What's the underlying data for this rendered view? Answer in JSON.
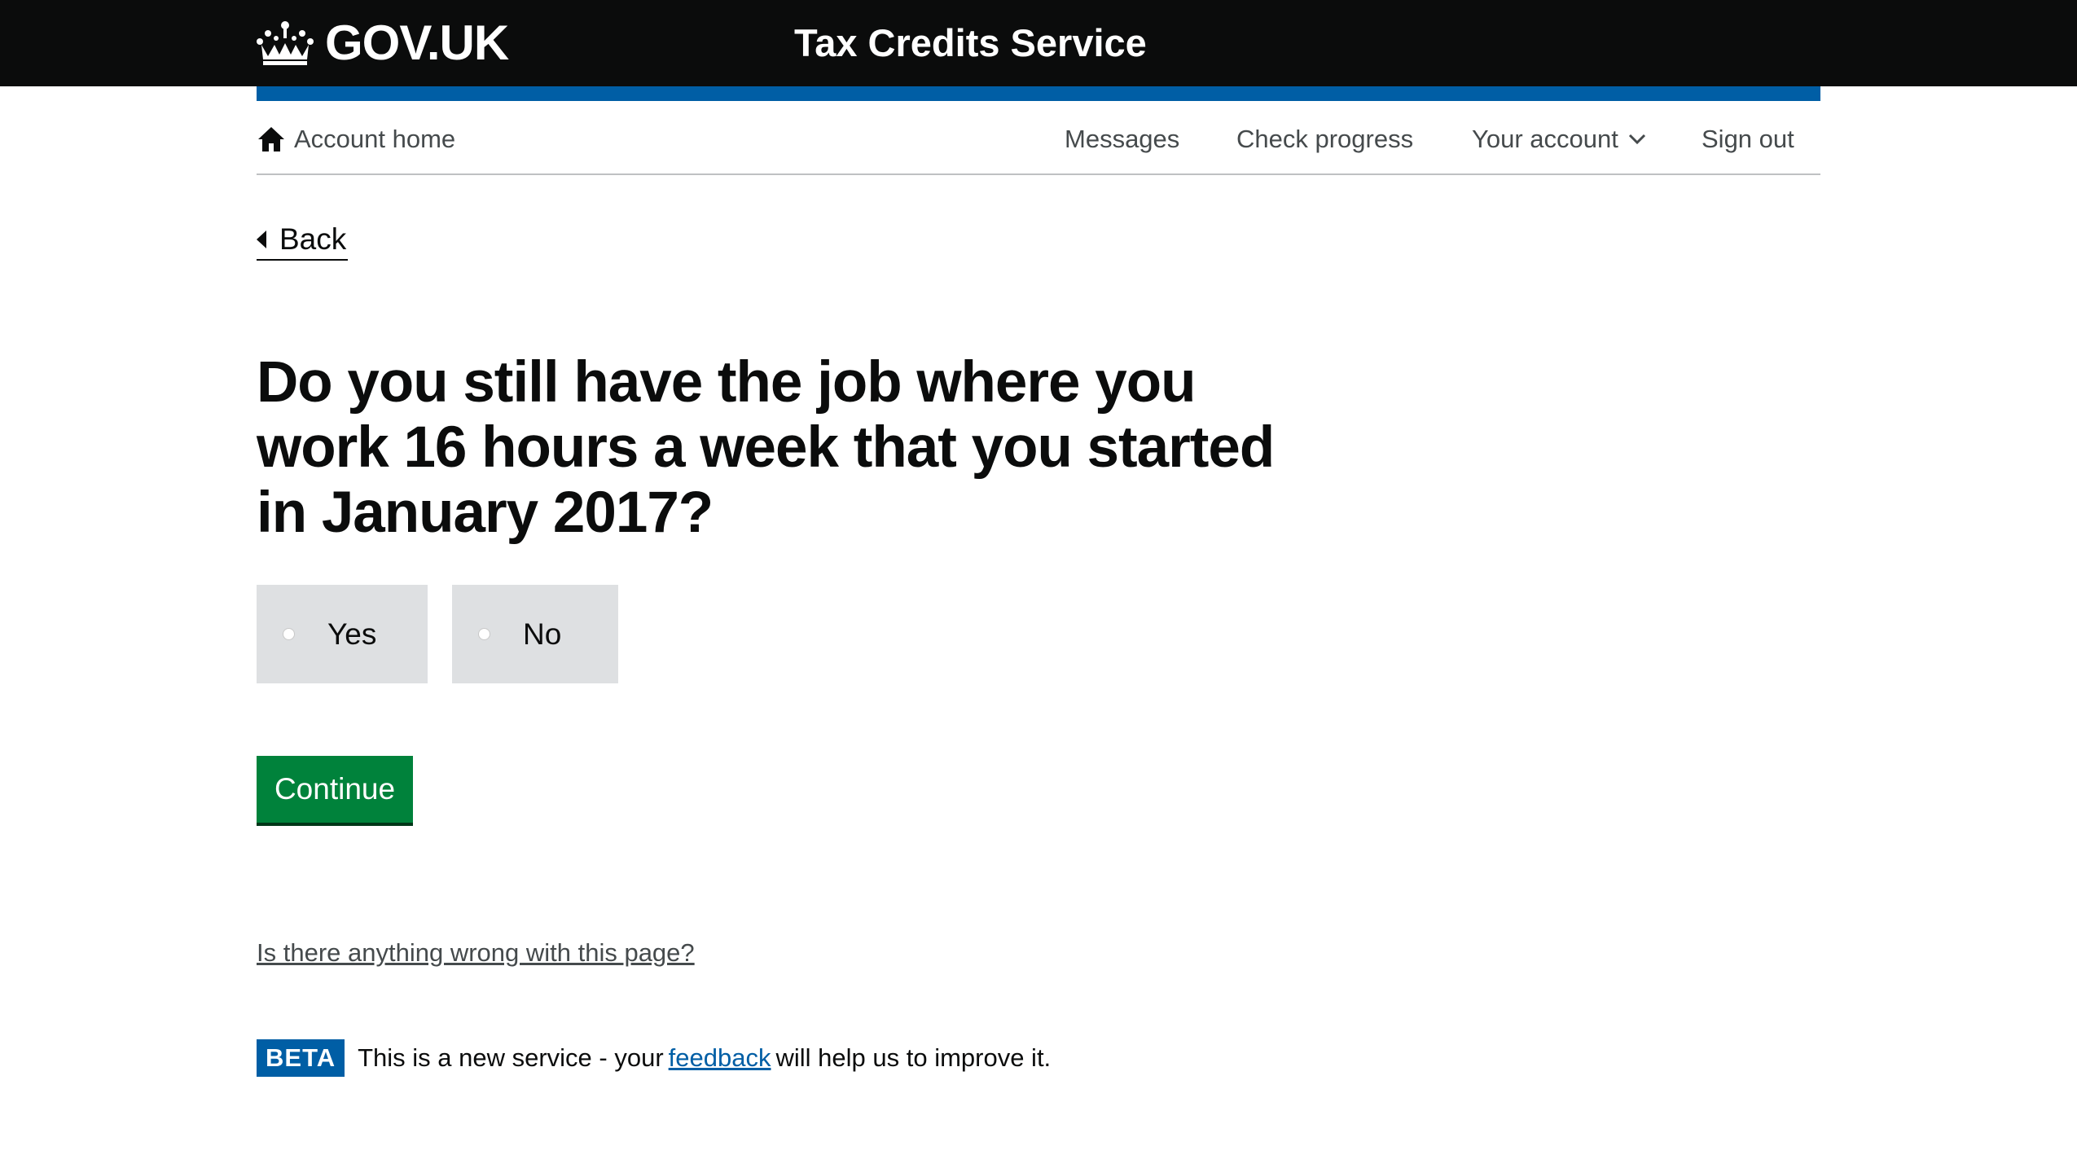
{
  "header": {
    "logo_text": "GOV.UK",
    "logo_icon": "crown-icon",
    "service_name": "Tax Credits Service",
    "background_color": "#0b0c0c",
    "accent_color": "#005ea5"
  },
  "account_nav": {
    "home_icon": "home-icon",
    "home_label": "Account home",
    "items": [
      {
        "label": "Messages"
      },
      {
        "label": "Check progress"
      },
      {
        "label": "Your account",
        "icon": "chevron-down-icon"
      },
      {
        "label": "Sign out"
      }
    ]
  },
  "back": {
    "icon": "back-arrow-icon",
    "label": "Back"
  },
  "question": {
    "heading": "Do you still have the job where you work 16 hours a week that you started in January 2017?",
    "options": [
      {
        "label": "Yes",
        "selected": false
      },
      {
        "label": "No",
        "selected": false
      }
    ]
  },
  "continue_button": {
    "label": "Continue",
    "color": "#00823b"
  },
  "report_link": "Is there anything wrong with this page?",
  "beta_banner": {
    "tag": "BETA",
    "text_before": "This is a new service  - your",
    "link": "feedback",
    "text_after": "will help us to improve it."
  }
}
